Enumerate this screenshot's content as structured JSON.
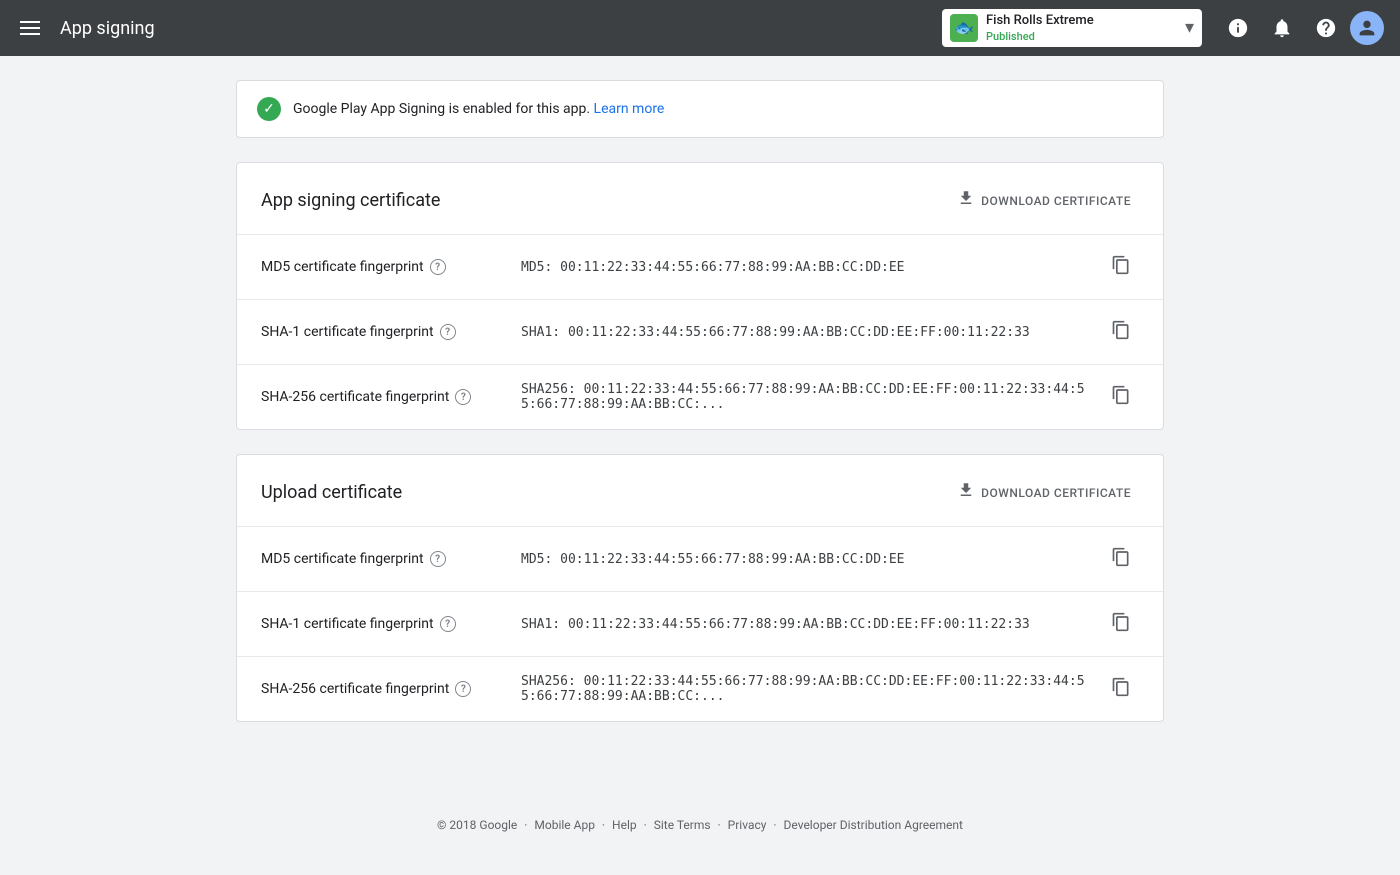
{
  "topnav": {
    "title": "App signing",
    "app_name": "Fish Rolls Extreme",
    "app_status": "Published",
    "app_icon": "🐟"
  },
  "banner": {
    "text": "Google Play App Signing is enabled for this app.",
    "link_text": "Learn more"
  },
  "app_signing_cert": {
    "title": "App signing certificate",
    "download_label": "DOWNLOAD CERTIFICATE",
    "rows": [
      {
        "label": "MD5 certificate fingerprint",
        "value": "MD5: 00:11:22:33:44:55:66:77:88:99:AA:BB:CC:DD:EE"
      },
      {
        "label": "SHA-1 certificate fingerprint",
        "value": "SHA1: 00:11:22:33:44:55:66:77:88:99:AA:BB:CC:DD:EE:FF:00:11:22:33"
      },
      {
        "label": "SHA-256 certificate fingerprint",
        "value": "SHA256: 00:11:22:33:44:55:66:77:88:99:AA:BB:CC:DD:EE:FF:00:11:22:33:44:55:66:77:88:99:AA:BB:CC:..."
      }
    ]
  },
  "upload_cert": {
    "title": "Upload certificate",
    "download_label": "DOWNLOAD CERTIFICATE",
    "rows": [
      {
        "label": "MD5 certificate fingerprint",
        "value": "MD5: 00:11:22:33:44:55:66:77:88:99:AA:BB:CC:DD:EE"
      },
      {
        "label": "SHA-1 certificate fingerprint",
        "value": "SHA1: 00:11:22:33:44:55:66:77:88:99:AA:BB:CC:DD:EE:FF:00:11:22:33"
      },
      {
        "label": "SHA-256 certificate fingerprint",
        "value": "SHA256: 00:11:22:33:44:55:66:77:88:99:AA:BB:CC:DD:EE:FF:00:11:22:33:44:55:66:77:88:99:AA:BB:CC:..."
      }
    ]
  },
  "footer": {
    "copyright": "© 2018 Google",
    "links": [
      "Mobile App",
      "Help",
      "Site Terms",
      "Privacy",
      "Developer Distribution Agreement"
    ]
  }
}
